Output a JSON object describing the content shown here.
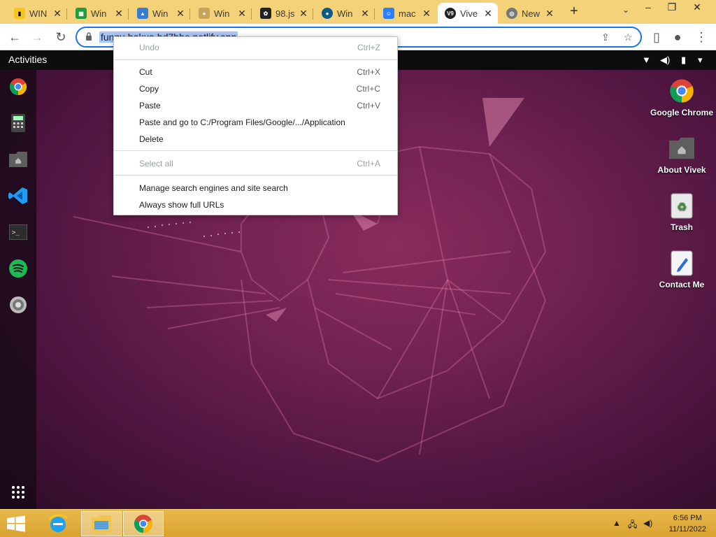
{
  "tabs": [
    {
      "title": "WIN",
      "icon": "imdb-icon",
      "color": "#f5c518"
    },
    {
      "title": "Win",
      "icon": "spreadsheet-icon",
      "color": "#1d9d3f"
    },
    {
      "title": "Win",
      "icon": "photo-icon",
      "color": "#3a7bd5"
    },
    {
      "title": "Win",
      "icon": "doge-icon",
      "color": "#c9a35a"
    },
    {
      "title": "98.js",
      "icon": "app-98-icon",
      "color": "#222222"
    },
    {
      "title": "Win",
      "icon": "win-icon",
      "color": "#0b5b86"
    },
    {
      "title": "mac",
      "icon": "finder-icon",
      "color": "#2d7ff9"
    },
    {
      "title": "Vive",
      "icon": "v9-icon",
      "color": "#202020"
    },
    {
      "title": "New",
      "icon": "chrome-icon",
      "color": "#777777"
    }
  ],
  "omnibox": {
    "url": "funny-bakus-bd7bbe.netlify.app"
  },
  "ubuntu_bar": {
    "activities": "Activities"
  },
  "context_menu": {
    "items": [
      {
        "label": "Undo",
        "shortcut": "Ctrl+Z",
        "disabled": true
      },
      {
        "label": "Cut",
        "shortcut": "Ctrl+X",
        "disabled": false
      },
      {
        "label": "Copy",
        "shortcut": "Ctrl+C",
        "disabled": false
      },
      {
        "label": "Paste",
        "shortcut": "Ctrl+V",
        "disabled": false
      },
      {
        "label": "Paste and go to C:/Program Files/Google/.../Application",
        "shortcut": "",
        "disabled": false
      },
      {
        "label": "Delete",
        "shortcut": "",
        "disabled": false
      },
      {
        "label": "Select all",
        "shortcut": "Ctrl+A",
        "disabled": true
      },
      {
        "label": "Manage search engines and site search",
        "shortcut": "",
        "disabled": false
      },
      {
        "label": "Always show full URLs",
        "shortcut": "",
        "disabled": false
      }
    ]
  },
  "dock": [
    "chrome-icon",
    "calculator-icon",
    "home-folder-icon",
    "vscode-icon",
    "terminal-icon",
    "spotify-icon",
    "settings-icon",
    "app-grid-icon"
  ],
  "desktop_icons": [
    {
      "label": "Google Chrome",
      "icon": "chrome-icon"
    },
    {
      "label": "About Vivek",
      "icon": "home-folder-icon"
    },
    {
      "label": "Trash",
      "icon": "trash-icon"
    },
    {
      "label": "Contact Me",
      "icon": "text-editor-icon"
    }
  ],
  "taskbar": {
    "time": "6:56 PM",
    "date": "11/11/2022",
    "apps": [
      "internet-explorer-icon",
      "file-explorer-icon",
      "chrome-icon"
    ]
  },
  "colors": {
    "tabstrip": "#f4d27a",
    "accent": "#1a73e8",
    "desktop": "#6e2150",
    "taskbar": "#e0ad3c"
  }
}
